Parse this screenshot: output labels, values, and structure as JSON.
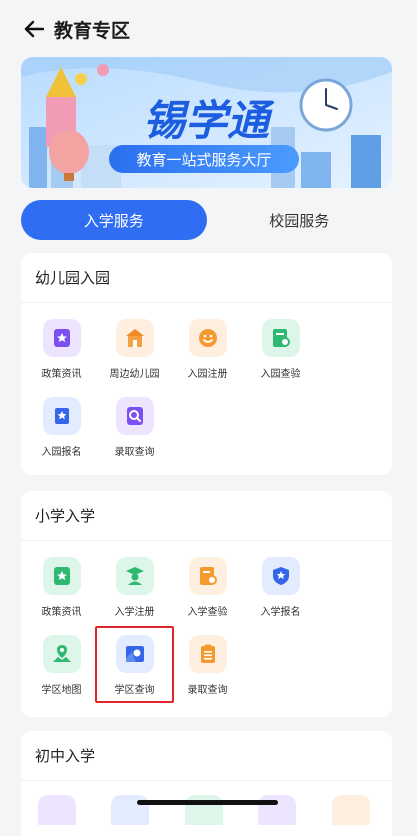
{
  "header": {
    "title": "教育专区"
  },
  "banner": {
    "brand": "锡学通",
    "tagline": "教育一站式服务大厅"
  },
  "tabs": [
    {
      "label": "入学服务",
      "active": true
    },
    {
      "label": "校园服务",
      "active": false
    }
  ],
  "sections": [
    {
      "title": "幼儿园入园",
      "items": [
        {
          "label": "政策资讯",
          "icon": "policy-icon",
          "color": "#8b5cf6"
        },
        {
          "label": "周边幼儿园",
          "icon": "kindergarten-icon",
          "color": "#f39a3a"
        },
        {
          "label": "入园注册",
          "icon": "smile-icon",
          "color": "#f39a3a"
        },
        {
          "label": "入园查验",
          "icon": "document-check-icon",
          "color": "#34c27a"
        },
        {
          "label": "入园报名",
          "icon": "star-flag-icon",
          "color": "#3f6df2"
        },
        {
          "label": "录取查询",
          "icon": "search-icon",
          "color": "#8b5cf6"
        }
      ]
    },
    {
      "title": "小学入学",
      "items": [
        {
          "label": "政策资讯",
          "icon": "policy-icon",
          "color": "#34c27a"
        },
        {
          "label": "入学注册",
          "icon": "graduate-icon",
          "color": "#34c27a"
        },
        {
          "label": "入学查验",
          "icon": "document-search-icon",
          "color": "#f39a3a"
        },
        {
          "label": "入学报名",
          "icon": "shield-star-icon",
          "color": "#3f6df2"
        },
        {
          "label": "学区地图",
          "icon": "map-pin-icon",
          "color": "#34c27a"
        },
        {
          "label": "学区查询",
          "icon": "location-search-icon",
          "color": "#3f6df2"
        },
        {
          "label": "录取查询",
          "icon": "clipboard-icon",
          "color": "#f39a3a"
        }
      ]
    },
    {
      "title": "初中入学",
      "items": []
    }
  ]
}
